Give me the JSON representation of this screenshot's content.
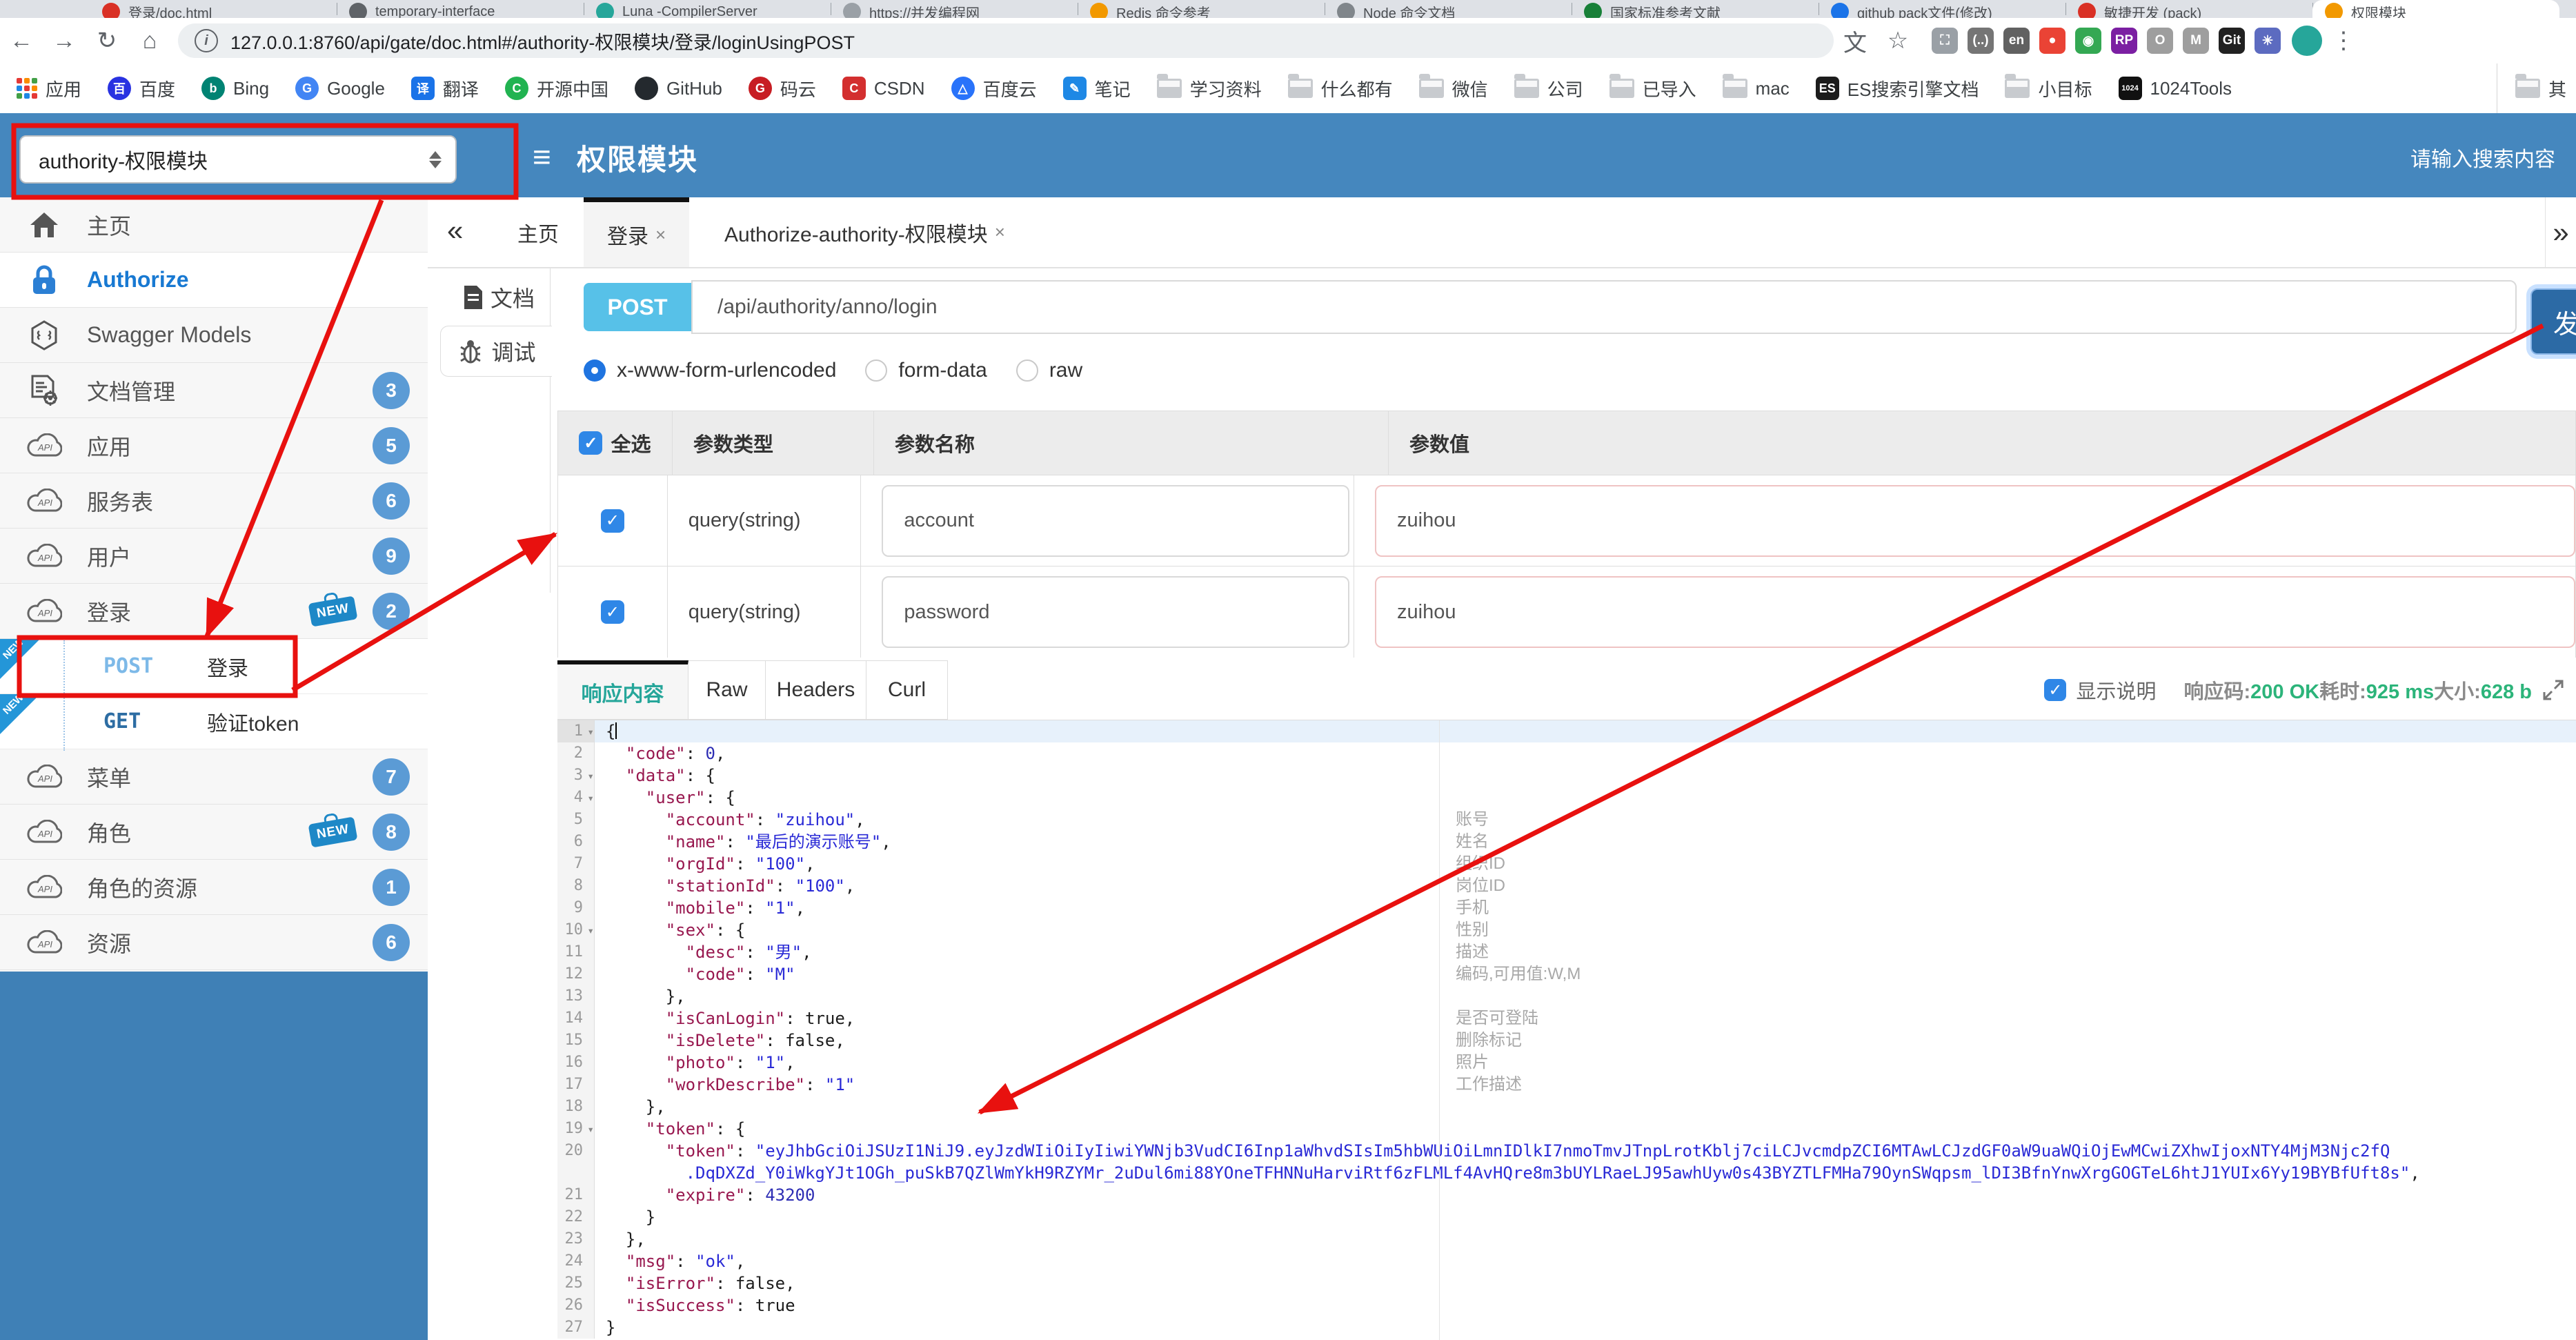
{
  "colors": {
    "header_blue": "#4587be",
    "sidebar_blue": "#3f80b6",
    "post_chip": "#57c1e8",
    "send_blue": "#2c6aa5",
    "badge_blue": "#5b9bd5",
    "green": "#2cb47a",
    "teal": "#26a69a",
    "annotation_red": "#e8110f",
    "key_maroon": "#98184f",
    "string_blue": "#2a2ad6"
  },
  "browser": {
    "url": "127.0.0.1:8760/api/gate/doc.html#/authority-权限模块/登录/loginUsingPOST",
    "tabs": [
      {
        "label": "登录/doc.html",
        "color": "#d93025"
      },
      {
        "label": "temporary-interface",
        "color": "#5f6368"
      },
      {
        "label": "Luna -CompilerServer",
        "color": "#26a69a"
      },
      {
        "label": "https://并发编程网",
        "color": "#9aa0a6"
      },
      {
        "label": "Redis 命令参考",
        "color": "#f29900"
      },
      {
        "label": "Node 命令文档",
        "color": "#80868b"
      },
      {
        "label": "国家标准参考文献",
        "color": "#188038"
      },
      {
        "label": "github pack文件(修改)",
        "color": "#1a73e8"
      },
      {
        "label": "敏捷开发 (pack)",
        "color": "#d93025"
      },
      {
        "label": "权限模块",
        "color": "#f29900",
        "active": true
      }
    ],
    "toolbar_icons": [
      {
        "name": "screenshot-icon",
        "color": "#9aa0a6",
        "ch": "⛶"
      },
      {
        "name": "notes-ext-icon",
        "color": "#757575",
        "ch": "(..)"
      },
      {
        "name": "translate-en-icon",
        "color": "#616161",
        "ch": "en"
      },
      {
        "name": "chrome-icon",
        "color": "#ea4335",
        "ch": "●"
      },
      {
        "name": "globe-icon",
        "color": "#34a853",
        "ch": "◉"
      },
      {
        "name": "rp-ext-icon",
        "color": "#7b1fa2",
        "ch": "RP"
      },
      {
        "name": "gray-circle-icon",
        "color": "#9e9e9e",
        "ch": "O"
      },
      {
        "name": "shield-icon",
        "color": "#9e9e9e",
        "ch": "M"
      },
      {
        "name": "gitzip-icon",
        "color": "#212121",
        "ch": "Git"
      },
      {
        "name": "pinwheel-icon",
        "color": "#5c6bc0",
        "ch": "✳"
      }
    ],
    "bookmarks": [
      {
        "label": "应用",
        "icon": "apps"
      },
      {
        "label": "百度",
        "icon": "dot",
        "color": "#2932e1",
        "ch": "百"
      },
      {
        "label": "Bing",
        "icon": "dot",
        "color": "#008373",
        "ch": "b"
      },
      {
        "label": "Google",
        "icon": "dot",
        "color": "#4285f4",
        "ch": "G"
      },
      {
        "label": "翻译",
        "icon": "sq",
        "color": "#1a73e8",
        "ch": "译"
      },
      {
        "label": "开源中国",
        "icon": "dot",
        "color": "#21b351",
        "ch": "C"
      },
      {
        "label": "GitHub",
        "icon": "dot",
        "color": "#24292e",
        "ch": ""
      },
      {
        "label": "码云",
        "icon": "dot",
        "color": "#c71d23",
        "ch": "G"
      },
      {
        "label": "CSDN",
        "icon": "sq",
        "color": "#d32f2f",
        "ch": "C"
      },
      {
        "label": "百度云",
        "icon": "dot",
        "color": "#2973fa",
        "ch": "△"
      },
      {
        "label": "笔记",
        "icon": "sq",
        "color": "#1e88e5",
        "ch": "✎"
      },
      {
        "label": "学习资料",
        "icon": "folder"
      },
      {
        "label": "什么都有",
        "icon": "folder"
      },
      {
        "label": "微信",
        "icon": "folder"
      },
      {
        "label": "公司",
        "icon": "folder"
      },
      {
        "label": "已导入",
        "icon": "folder"
      },
      {
        "label": "mac",
        "icon": "folder"
      },
      {
        "label": "ES搜索引擎文档",
        "icon": "sq",
        "color": "#1c1c1c",
        "ch": "ES"
      },
      {
        "label": "小目标",
        "icon": "folder"
      },
      {
        "label": "1024Tools",
        "icon": "sq",
        "color": "#111111",
        "ch": "1024"
      }
    ],
    "bookmarks_overflow": "其"
  },
  "header": {
    "module_select": "authority-权限模块",
    "title": "权限模块",
    "hamburger": "≡",
    "search_placeholder": "请输入搜索内容"
  },
  "sidebar": {
    "items": [
      {
        "label": "主页",
        "icon": "home"
      },
      {
        "label": "Authorize",
        "icon": "lock",
        "active": true
      },
      {
        "label": "Swagger Models",
        "icon": "swagger"
      },
      {
        "label": "文档管理",
        "icon": "docs",
        "badge": "3"
      },
      {
        "label": "应用",
        "icon": "api",
        "badge": "5"
      },
      {
        "label": "服务表",
        "icon": "api",
        "badge": "6"
      },
      {
        "label": "用户",
        "icon": "api",
        "badge": "9"
      },
      {
        "label": "登录",
        "icon": "api",
        "badge": "2",
        "new": true,
        "children": [
          {
            "method": "POST",
            "label": "登录",
            "new": true
          },
          {
            "method": "GET",
            "label": "验证token",
            "new": true
          }
        ]
      },
      {
        "label": "菜单",
        "icon": "api",
        "badge": "7"
      },
      {
        "label": "角色",
        "icon": "api",
        "badge": "8",
        "new": true
      },
      {
        "label": "角色的资源",
        "icon": "api",
        "badge": "1"
      },
      {
        "label": "资源",
        "icon": "api",
        "badge": "6"
      }
    ]
  },
  "doc_tabs": {
    "collapse": "«",
    "expand": "»",
    "tabs": [
      {
        "label": "主页"
      },
      {
        "label": "登录",
        "closable": true,
        "active": true
      },
      {
        "label": "Authorize-authority-权限模块",
        "closable": true
      }
    ]
  },
  "side_tabs": [
    {
      "label": "文档",
      "icon": "doc"
    },
    {
      "label": "调试",
      "icon": "bug",
      "active": true
    }
  ],
  "debug": {
    "method": "POST",
    "path": "/api/authority/anno/login",
    "send_label": "发",
    "body_types": [
      {
        "label": "x-www-form-urlencoded",
        "selected": true
      },
      {
        "label": "form-data",
        "selected": false
      },
      {
        "label": "raw",
        "selected": false
      }
    ],
    "table": {
      "headers": {
        "all": "全选",
        "type": "参数类型",
        "name": "参数名称",
        "value": "参数值"
      },
      "rows": [
        {
          "checked": true,
          "type": "query(string)",
          "name": "account",
          "value": "zuihou"
        },
        {
          "checked": true,
          "type": "query(string)",
          "name": "password",
          "value": "zuihou"
        }
      ]
    },
    "response": {
      "tabs": [
        {
          "label": "响应内容",
          "active": true
        },
        {
          "label": "Raw"
        },
        {
          "label": "Headers"
        },
        {
          "label": "Curl"
        }
      ],
      "show_desc_label": "显示说明",
      "show_desc_checked": true,
      "stats": [
        {
          "label": "响应码:",
          "value": "200 OK"
        },
        {
          "label": "耗时:",
          "value": "925 ms"
        },
        {
          "label": "大小:",
          "value": "628 b"
        }
      ]
    }
  },
  "editor": {
    "lines": [
      {
        "n": 1,
        "fold": true,
        "active": true,
        "cursor": true,
        "seg": [
          [
            "{",
            "p"
          ]
        ]
      },
      {
        "n": 2,
        "seg": [
          [
            "  ",
            "p"
          ],
          [
            "\"code\"",
            "k"
          ],
          [
            ": ",
            "p"
          ],
          [
            "0",
            "n"
          ],
          [
            ",",
            "p"
          ]
        ]
      },
      {
        "n": 3,
        "fold": true,
        "seg": [
          [
            "  ",
            "p"
          ],
          [
            "\"data\"",
            "k"
          ],
          [
            ": {",
            "p"
          ]
        ]
      },
      {
        "n": 4,
        "fold": true,
        "seg": [
          [
            "    ",
            "p"
          ],
          [
            "\"user\"",
            "k"
          ],
          [
            ": {",
            "p"
          ]
        ]
      },
      {
        "n": 5,
        "note": "账号",
        "seg": [
          [
            "      ",
            "p"
          ],
          [
            "\"account\"",
            "k"
          ],
          [
            ": ",
            "p"
          ],
          [
            "\"zuihou\"",
            "s"
          ],
          [
            ",",
            "p"
          ]
        ]
      },
      {
        "n": 6,
        "note": "姓名",
        "seg": [
          [
            "      ",
            "p"
          ],
          [
            "\"name\"",
            "k"
          ],
          [
            ": ",
            "p"
          ],
          [
            "\"最后的演示账号\"",
            "s"
          ],
          [
            ",",
            "p"
          ]
        ]
      },
      {
        "n": 7,
        "note": "组织ID",
        "seg": [
          [
            "      ",
            "p"
          ],
          [
            "\"orgId\"",
            "k"
          ],
          [
            ": ",
            "p"
          ],
          [
            "\"100\"",
            "s"
          ],
          [
            ",",
            "p"
          ]
        ]
      },
      {
        "n": 8,
        "note": "岗位ID",
        "seg": [
          [
            "      ",
            "p"
          ],
          [
            "\"stationId\"",
            "k"
          ],
          [
            ": ",
            "p"
          ],
          [
            "\"100\"",
            "s"
          ],
          [
            ",",
            "p"
          ]
        ]
      },
      {
        "n": 9,
        "note": "手机",
        "seg": [
          [
            "      ",
            "p"
          ],
          [
            "\"mobile\"",
            "k"
          ],
          [
            ": ",
            "p"
          ],
          [
            "\"1\"",
            "s"
          ],
          [
            ",",
            "p"
          ]
        ]
      },
      {
        "n": 10,
        "fold": true,
        "note": "性别",
        "seg": [
          [
            "      ",
            "p"
          ],
          [
            "\"sex\"",
            "k"
          ],
          [
            ": {",
            "p"
          ]
        ]
      },
      {
        "n": 11,
        "note": "描述",
        "seg": [
          [
            "        ",
            "p"
          ],
          [
            "\"desc\"",
            "k"
          ],
          [
            ": ",
            "p"
          ],
          [
            "\"男\"",
            "s"
          ],
          [
            ",",
            "p"
          ]
        ]
      },
      {
        "n": 12,
        "note": "编码,可用值:W,M",
        "seg": [
          [
            "        ",
            "p"
          ],
          [
            "\"code\"",
            "k"
          ],
          [
            ": ",
            "p"
          ],
          [
            "\"M\"",
            "s"
          ]
        ]
      },
      {
        "n": 13,
        "seg": [
          [
            "      },",
            "p"
          ]
        ]
      },
      {
        "n": 14,
        "note": "是否可登陆",
        "seg": [
          [
            "      ",
            "p"
          ],
          [
            "\"isCanLogin\"",
            "k"
          ],
          [
            ": ",
            "p"
          ],
          [
            "true",
            "b"
          ],
          [
            ",",
            "p"
          ]
        ]
      },
      {
        "n": 15,
        "note": "删除标记",
        "seg": [
          [
            "      ",
            "p"
          ],
          [
            "\"isDelete\"",
            "k"
          ],
          [
            ": ",
            "p"
          ],
          [
            "false",
            "b"
          ],
          [
            ",",
            "p"
          ]
        ]
      },
      {
        "n": 16,
        "note": "照片",
        "seg": [
          [
            "      ",
            "p"
          ],
          [
            "\"photo\"",
            "k"
          ],
          [
            ": ",
            "p"
          ],
          [
            "\"1\"",
            "s"
          ],
          [
            ",",
            "p"
          ]
        ]
      },
      {
        "n": 17,
        "note": "工作描述",
        "seg": [
          [
            "      ",
            "p"
          ],
          [
            "\"workDescribe\"",
            "k"
          ],
          [
            ": ",
            "p"
          ],
          [
            "\"1\"",
            "s"
          ]
        ]
      },
      {
        "n": 18,
        "seg": [
          [
            "    },",
            "p"
          ]
        ]
      },
      {
        "n": 19,
        "fold": true,
        "seg": [
          [
            "    ",
            "p"
          ],
          [
            "\"token\"",
            "k"
          ],
          [
            ": {",
            "p"
          ]
        ]
      },
      {
        "n": 20,
        "seg": [
          [
            "      ",
            "p"
          ],
          [
            "\"token\"",
            "k"
          ],
          [
            ": ",
            "p"
          ],
          [
            "\"eyJhbGciOiJSUzI1NiJ9.eyJzdWIiOiIyIiwiYWNjb3VudCI6Inp1aWhvdSIsIm5hbWUiOiLmnIDlkI7nmoTmvJTnpLrotKblj7ciLCJvcmdpZCI6MTAwLCJzdGF0aW9uaWQiOjEwMCwiZXhwIjoxNTY4MjM3Njc2fQ",
            "s"
          ]
        ],
        "wrap": [
          [
            "        ",
            "p"
          ],
          [
            ".DqDXZd_Y0iWkgYJt1OGh_puSkB7QZlWmYkH9RZYMr_2uDul6mi88YOneTFHNNuHarviRtf6zFLMLf4AvHQre8m3bUYLRaeLJ95awhUyw0s43BYZTLFMHa79OynSWqpsm_lDI3BfnYnwXrgGOGTeL6htJ1YUIx6Yy19BYBfUft8s\"",
            "s"
          ],
          [
            ",",
            "p"
          ]
        ]
      },
      {
        "n": 21,
        "seg": [
          [
            "      ",
            "p"
          ],
          [
            "\"expire\"",
            "k"
          ],
          [
            ": ",
            "p"
          ],
          [
            "43200",
            "n"
          ]
        ]
      },
      {
        "n": 22,
        "seg": [
          [
            "    }",
            "p"
          ]
        ]
      },
      {
        "n": 23,
        "seg": [
          [
            "  },",
            "p"
          ]
        ]
      },
      {
        "n": 24,
        "seg": [
          [
            "  ",
            "p"
          ],
          [
            "\"msg\"",
            "k"
          ],
          [
            ": ",
            "p"
          ],
          [
            "\"ok\"",
            "s"
          ],
          [
            ",",
            "p"
          ]
        ]
      },
      {
        "n": 25,
        "seg": [
          [
            "  ",
            "p"
          ],
          [
            "\"isError\"",
            "k"
          ],
          [
            ": ",
            "p"
          ],
          [
            "false",
            "b"
          ],
          [
            ",",
            "p"
          ]
        ]
      },
      {
        "n": 26,
        "seg": [
          [
            "  ",
            "p"
          ],
          [
            "\"isSuccess\"",
            "k"
          ],
          [
            ": ",
            "p"
          ],
          [
            "true",
            "b"
          ]
        ]
      },
      {
        "n": 27,
        "seg": [
          [
            "}",
            "p"
          ]
        ]
      }
    ]
  }
}
